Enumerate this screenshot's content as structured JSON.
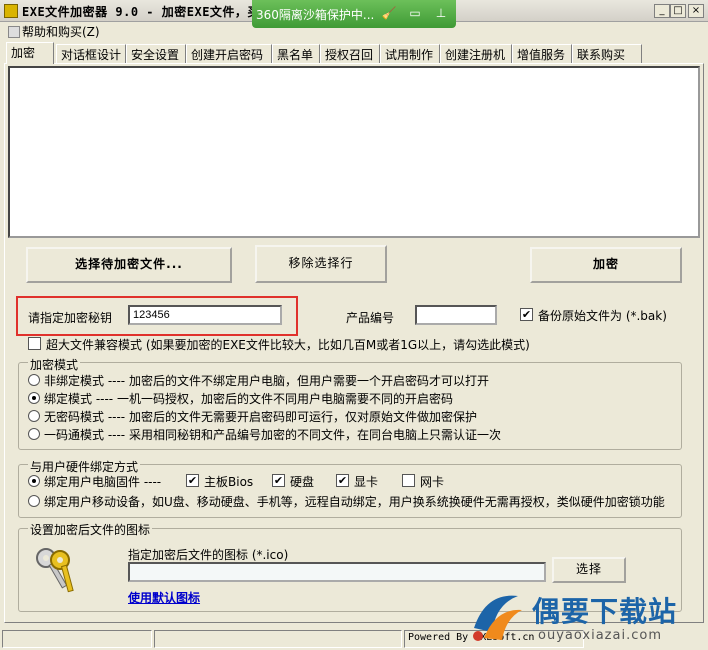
{
  "window": {
    "title": "EXE文件加密器 9.0 - 加密EXE文件，买",
    "min_label": "_",
    "max_label": "□",
    "close_label": "×"
  },
  "sandbox": {
    "text": "360隔离沙箱保护中..."
  },
  "menu": {
    "help_buy": "帮助和购买(Z)"
  },
  "tabs": [
    "加密",
    "对话框设计",
    "安全设置",
    "创建开启密码",
    "黑名单",
    "授权召回",
    "试用制作",
    "创建注册机",
    "增值服务",
    "联系购买"
  ],
  "actions": {
    "select_file": "选择待加密文件...",
    "remove_selected": "移除选择行",
    "encrypt": "加密"
  },
  "fields": {
    "key_label": "请指定加密秘钥",
    "key_value": "123456",
    "product_label": "产品编号",
    "product_value": "",
    "backup_label": "备份原始文件为 (*.bak)",
    "backup_checked": true,
    "compat_label": "超大文件兼容模式 (如果要加密的EXE文件比较大，比如几百M或者1G以上，请勾选此模式)",
    "compat_checked": false
  },
  "encrypt_mode": {
    "legend": "加密模式",
    "options": [
      {
        "label": "非绑定模式 ---- 加密后的文件不绑定用户电脑，但用户需要一个开启密码才可以打开",
        "selected": false
      },
      {
        "label": "绑定模式 ---- 一机一码授权，加密后的文件不同用户电脑需要不同的开启密码",
        "selected": true
      },
      {
        "label": "无密码模式 ---- 加密后的文件无需要开启密码即可运行，仅对原始文件做加密保护",
        "selected": false
      },
      {
        "label": "一码通模式 ---- 采用相同秘钥和产品编号加密的不同文件，在同台电脑上只需认证一次",
        "selected": false
      }
    ]
  },
  "hardware": {
    "legend": "与用户硬件绑定方式",
    "pc_label": "绑定用户电脑固件 ----",
    "pc_selected": true,
    "mobile_label": "绑定用户移动设备，如U盘、移动硬盘、手机等，远程自动绑定，用户换系统换硬件无需再授权，类似硬件加密锁功能",
    "mobile_selected": false,
    "items": [
      {
        "label": "主板Bios",
        "checked": true
      },
      {
        "label": "硬盘",
        "checked": true
      },
      {
        "label": "显卡",
        "checked": true
      },
      {
        "label": "网卡",
        "checked": false
      }
    ]
  },
  "icon_group": {
    "legend": "设置加密后文件的图标",
    "prompt": "指定加密后文件的图标 (*.ico)",
    "path_value": "",
    "choose": "选择",
    "default_link": "使用默认图标"
  },
  "status": {
    "powered": "Powered By EXEsoft.cn"
  },
  "watermark": {
    "main": "偶要下载站",
    "sub": "ouyaoxiazai.com"
  },
  "colors": {
    "highlight_box": "#e0312c",
    "sandbox_green": "#4caf40",
    "link": "#0000cc",
    "watermark_blue": "#1c64a8"
  }
}
